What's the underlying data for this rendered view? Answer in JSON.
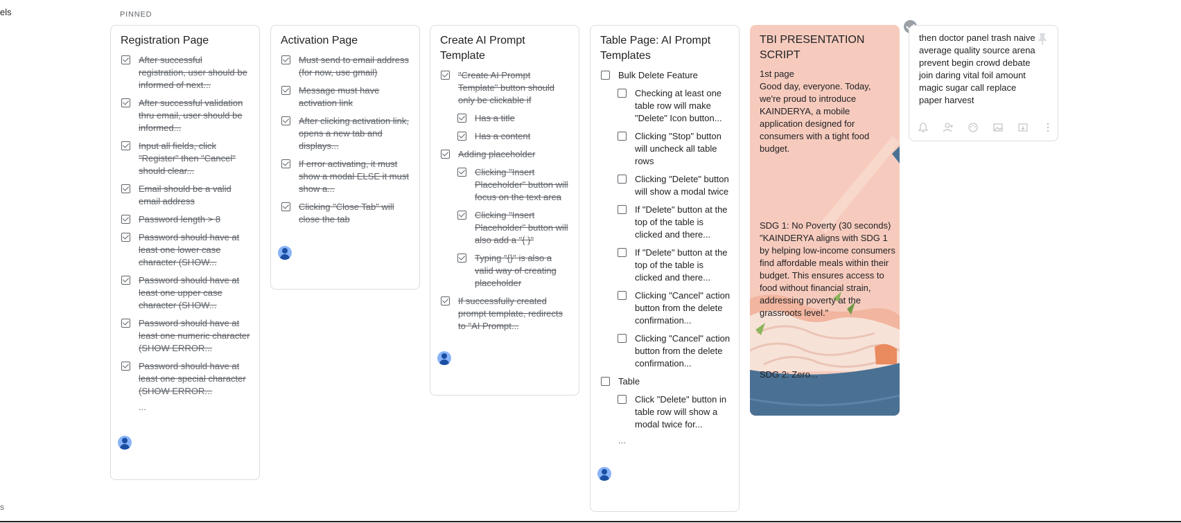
{
  "edge": {
    "top_label": "els",
    "bottom_label": "s"
  },
  "section_label": "PINNED",
  "notes": [
    {
      "title": "Registration Page",
      "items": [
        {
          "text": "After successful registration, user should be informed of next...",
          "checked": true
        },
        {
          "text": "After successful validation thru email, user should be informed...",
          "checked": true
        },
        {
          "text": "Input all fields, click \"Register\" then \"Cancel\" should clear...",
          "checked": true
        },
        {
          "text": "Email should be a valid email address",
          "checked": true
        },
        {
          "text": "Password length > 8",
          "checked": true
        },
        {
          "text": "Password should have at least one lower case character (SHOW...",
          "checked": true
        },
        {
          "text": "Password should have at least one upper case character (SHOW...",
          "checked": true
        },
        {
          "text": "Password should have at least one numeric character (SHOW ERROR...",
          "checked": true
        },
        {
          "text": "Password should have at least one special character (SHOW ERROR...",
          "checked": true
        }
      ],
      "more": "..."
    },
    {
      "title": "Activation Page",
      "items": [
        {
          "text": "Must send to email address (for now, use gmail)",
          "checked": true
        },
        {
          "text": "Message must have activation link",
          "checked": true
        },
        {
          "text": "After clicking activation link, opens a new tab and displays...",
          "checked": true
        },
        {
          "text": "If error activating, it must show a modal ELSE it must show a...",
          "checked": true
        },
        {
          "text": "Clicking \"Close Tab\" will close the tab",
          "checked": true
        }
      ]
    },
    {
      "title": "Create AI Prompt Template",
      "items": [
        {
          "text": "\"Create AI Prompt Template\" button should only be clickable if",
          "checked": true,
          "sub": false
        },
        {
          "text": "Has a title",
          "checked": true,
          "sub": true
        },
        {
          "text": "Has a content",
          "checked": true,
          "sub": true
        },
        {
          "text": "Adding placeholder",
          "checked": true,
          "sub": false
        },
        {
          "text": "Clicking \"Insert Placeholder\" button will focus on the text area",
          "checked": true,
          "sub": true
        },
        {
          "text": "Clicking \"Insert Placeholder\" button will also add a \"{ }\"",
          "checked": true,
          "sub": true
        },
        {
          "text": "Typing \"{}\" is also a valid way of creating placeholder",
          "checked": true,
          "sub": true
        },
        {
          "text": "If successfully created prompt template, redirects to \"AI Prompt...",
          "checked": true,
          "sub": false
        }
      ]
    },
    {
      "title": "Table Page: AI Prompt Templates",
      "items": [
        {
          "text": "Bulk Delete Feature",
          "checked": false,
          "sub": false
        },
        {
          "text": "Checking at least one table row will make \"Delete\" Icon button...",
          "checked": false,
          "sub": true
        },
        {
          "text": "Clicking \"Stop\" button will uncheck all table rows",
          "checked": false,
          "sub": true
        },
        {
          "text": "Clicking \"Delete\" button will show a modal twice",
          "checked": false,
          "sub": true
        },
        {
          "text": "If \"Delete\" button at the top of the table is clicked and there...",
          "checked": false,
          "sub": true
        },
        {
          "text": "If \"Delete\" button at the top of the table is clicked and there...",
          "checked": false,
          "sub": true
        },
        {
          "text": "Clicking \"Cancel\" action button from the delete confirmation...",
          "checked": false,
          "sub": true
        },
        {
          "text": "Clicking \"Cancel\" action button from the delete confirmation...",
          "checked": false,
          "sub": true
        },
        {
          "text": "Table",
          "checked": false,
          "sub": false
        },
        {
          "text": "Click \"Delete\" button in table row will show a modal twice for...",
          "checked": false,
          "sub": true
        }
      ],
      "more": "..."
    }
  ],
  "presentation": {
    "title": "TBI PRESENTATION SCRIPT",
    "intro": "1st page\nGood day, everyone. Today, we're proud to introduce KAINDERYA, a mobile application designed for consumers with a tight food budget.",
    "sdg1": "SDG 1: No Poverty (30 seconds) \"KAINDERYA aligns with SDG 1 by helping low-income consumers find affordable meals within their budget. This ensures access to food without financial strain, addressing poverty at the grassroots level.\"",
    "sdg2": "SDG 2: Zero...",
    "colors": {
      "background": "#f6cbbd",
      "bowl": "#4a7194"
    }
  },
  "plain_note": {
    "text": "then doctor panel trash naive average quality source arena prevent begin crowd debate join daring vital foil amount magic sugar call replace paper harvest"
  }
}
